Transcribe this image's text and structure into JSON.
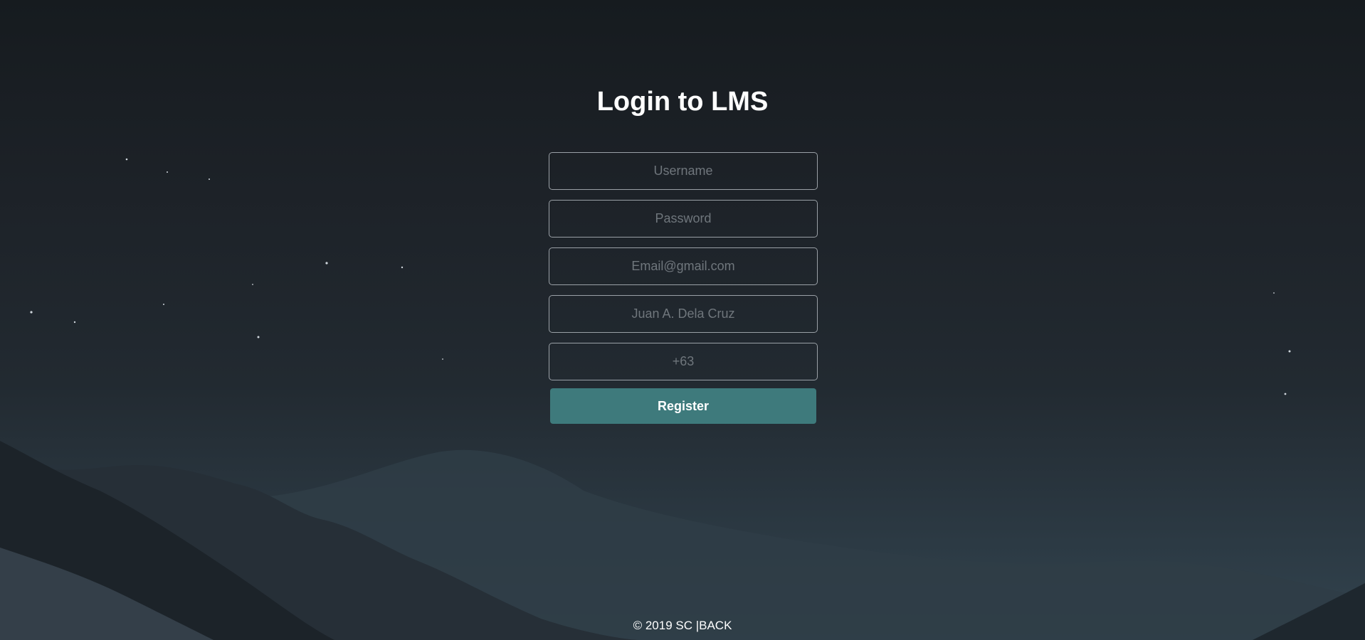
{
  "page": {
    "title": "Login to LMS"
  },
  "form": {
    "username_placeholder": "Username",
    "password_placeholder": "Password",
    "email_placeholder": "Email@gmail.com",
    "fullname_placeholder": "Juan A. Dela Cruz",
    "phone_placeholder": "+63",
    "register_label": "Register"
  },
  "footer": {
    "copyright": "© 2019 SC |",
    "back_label": "BACK"
  },
  "colors": {
    "accent": "#3e7a7c",
    "text": "#ffffff",
    "field_border": "#9aa0a6"
  }
}
